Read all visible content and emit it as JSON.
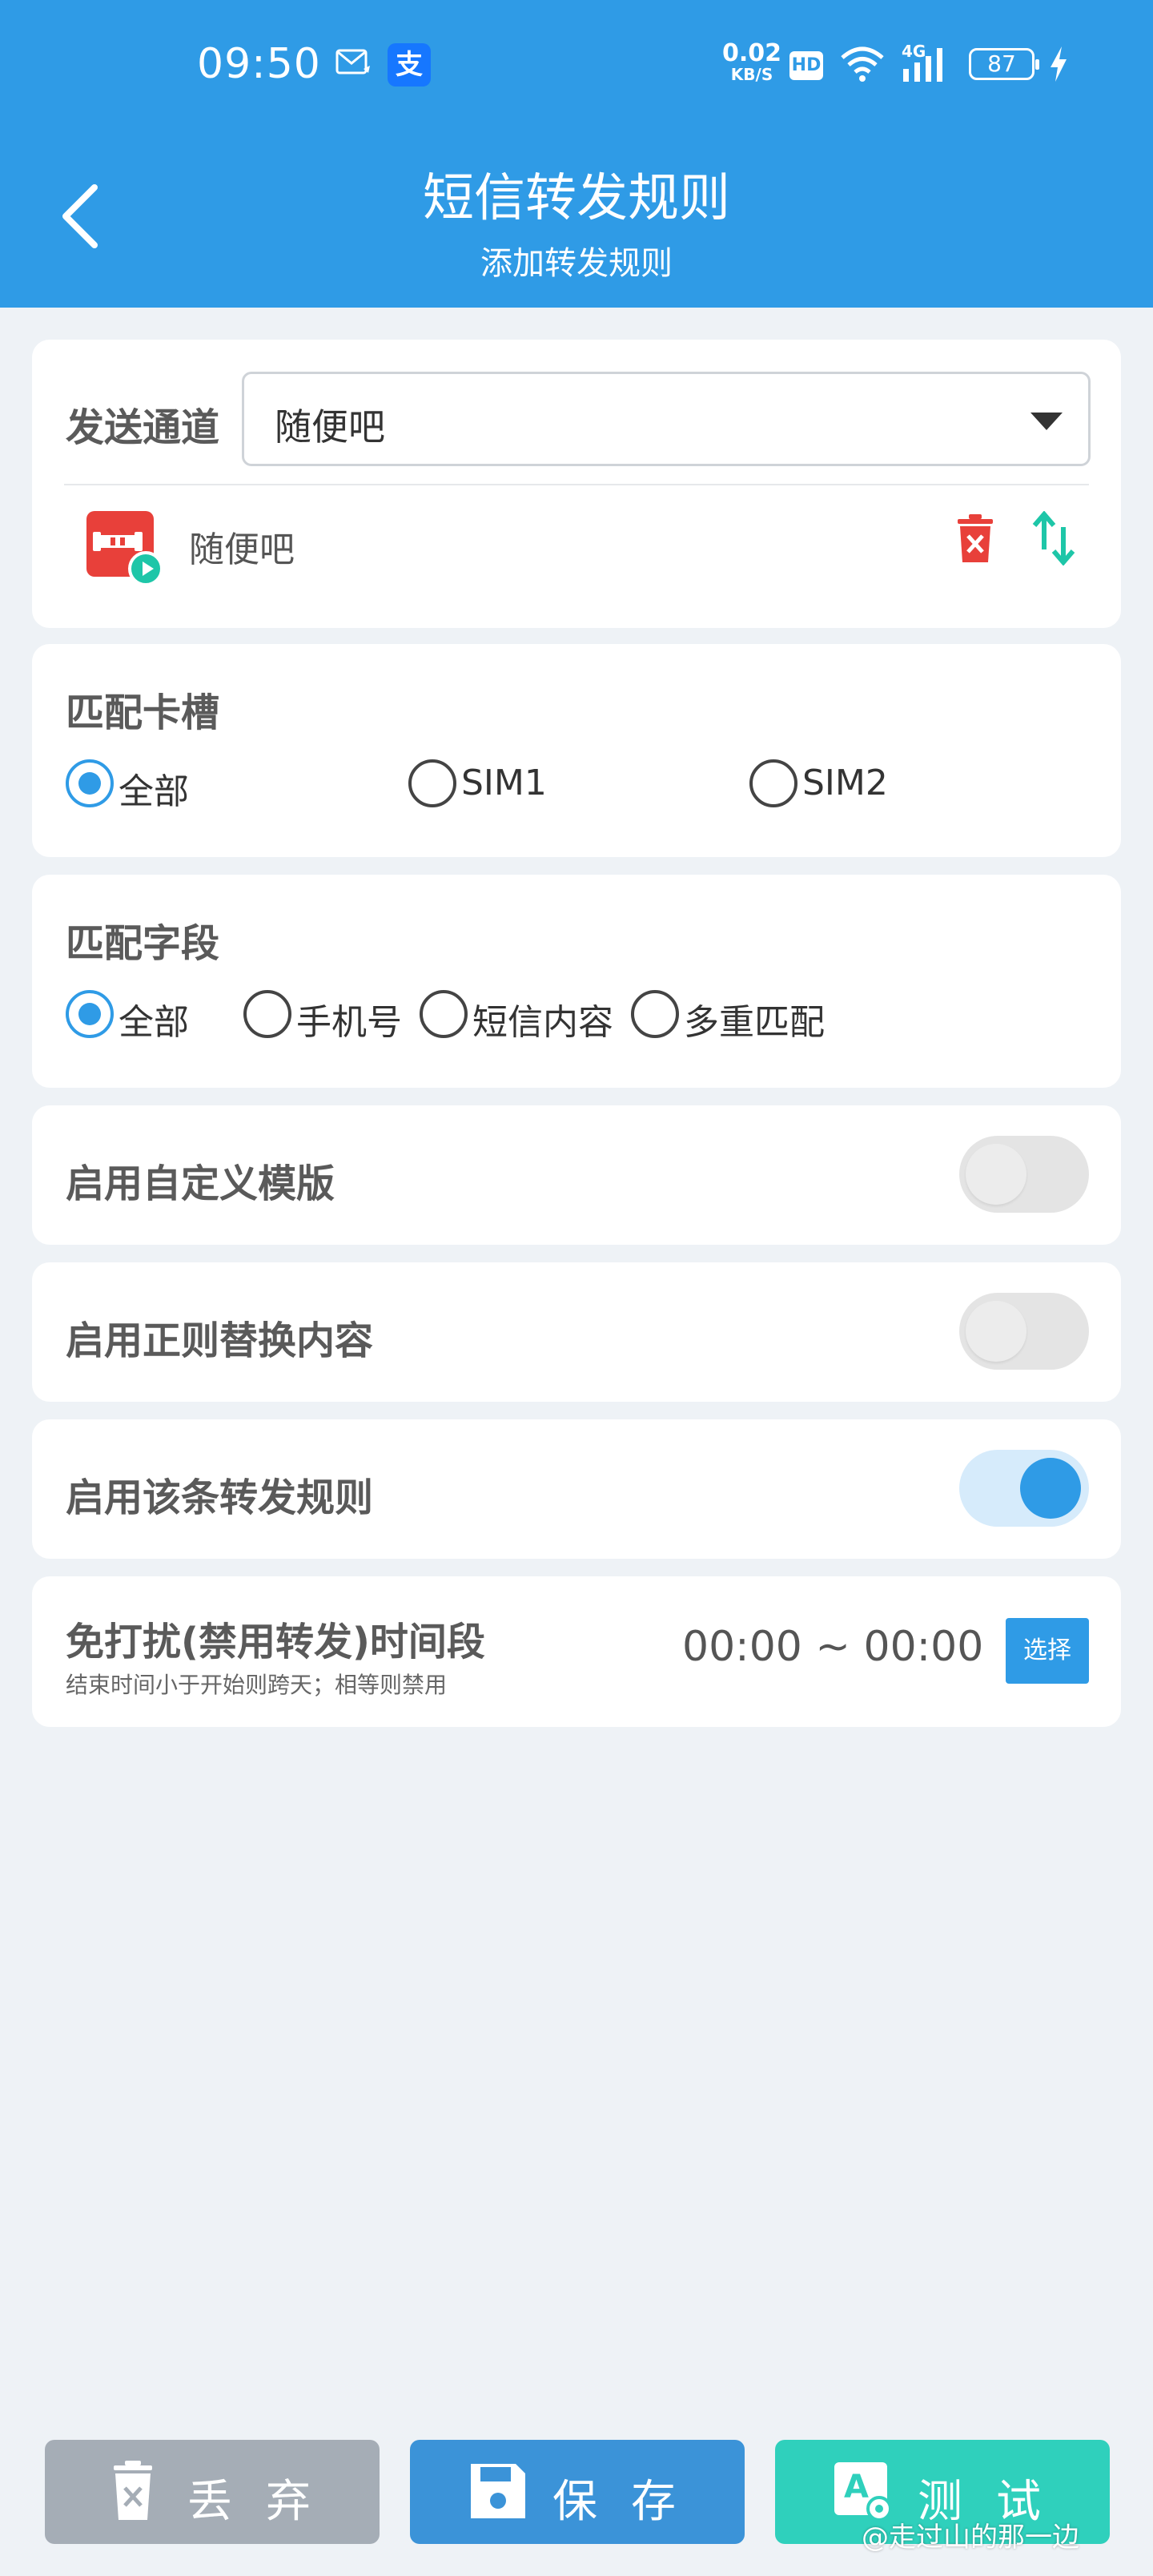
{
  "status_bar": {
    "time": "09:50",
    "net_speed": "0.02",
    "net_speed_unit": "KB/S",
    "hd": "HD",
    "network_type": "4G",
    "battery": "87",
    "alipay_glyph": "支"
  },
  "header": {
    "title": "短信转发规则",
    "subtitle": "添加转发规则"
  },
  "channel": {
    "label": "发送通道",
    "selected": "随便吧",
    "item_name": "随便吧"
  },
  "sim_slot": {
    "label": "匹配卡槽",
    "options": [
      "全部",
      "SIM1",
      "SIM2"
    ],
    "selected": "全部"
  },
  "match_field": {
    "label": "匹配字段",
    "options": [
      "全部",
      "手机号",
      "短信内容",
      "多重匹配"
    ],
    "selected": "全部"
  },
  "toggles": [
    {
      "label": "启用自定义模版",
      "on": false
    },
    {
      "label": "启用正则替换内容",
      "on": false
    },
    {
      "label": "启用该条转发规则",
      "on": true
    }
  ],
  "dnd": {
    "title": "免打扰(禁用转发)时间段",
    "hint": "结束时间小于开始则跨天；相等则禁用",
    "range": "00:00 ~ 00:00",
    "choose_label": "选择"
  },
  "buttons": {
    "discard": "丢弃",
    "save": "保存",
    "test": "测试"
  },
  "watermark": "@走过山的那一边",
  "colors": {
    "primary": "#2f9be6",
    "danger": "#e8403a",
    "teal": "#2fd0bc",
    "discard_gray": "#a5adb6"
  }
}
